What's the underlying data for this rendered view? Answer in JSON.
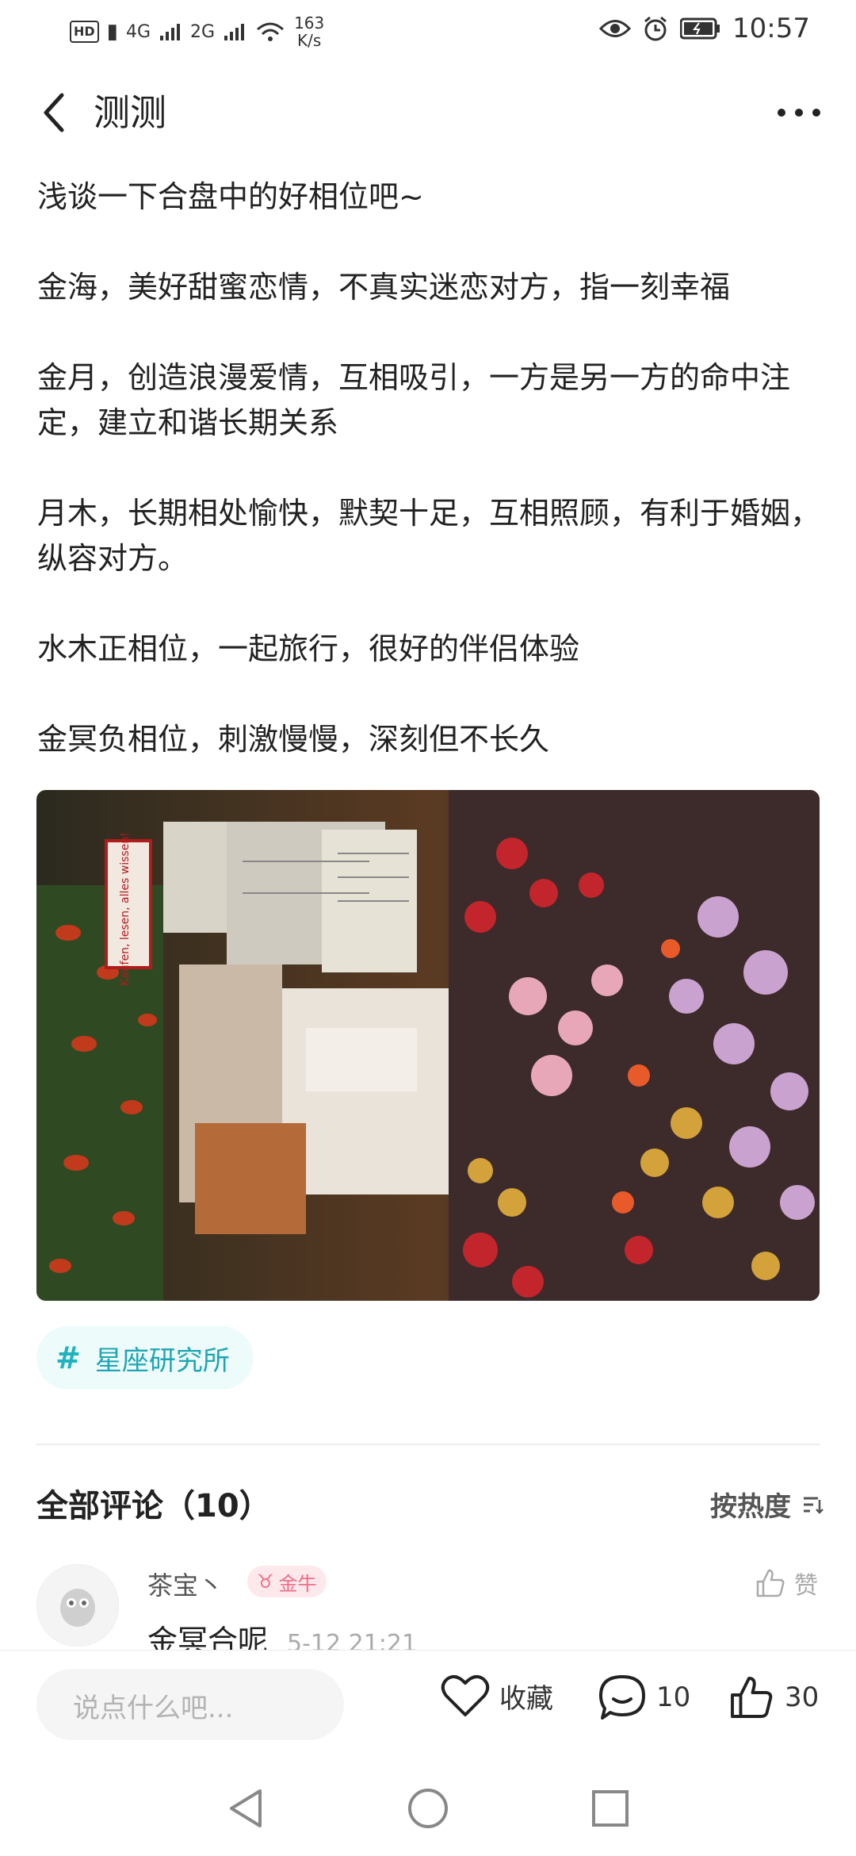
{
  "status_bar": {
    "hd": "HD",
    "signal1": "4G",
    "signal2": "2G",
    "speed_value": "163",
    "speed_unit": "K/s",
    "time": "10:57"
  },
  "header": {
    "title": "测测"
  },
  "post": {
    "paragraphs": [
      "浅谈一下合盘中的好相位吧~",
      "金海，美好甜蜜恋情，不真实迷恋对方，指一刻幸福",
      "金月，创造浪漫爱情，互相吸引，一方是另一方的命中注定，建立和谐长期关系",
      "月木，长期相处愉快，默契十足，互相照顾，有利于婚姻，纵容对方。",
      "水木正相位，一起旅行，很好的伴侣体验",
      "金冥负相位，刺激慢慢，深刻但不长久"
    ],
    "photo_sign_text": "Kaufen, lesen, alles wissen!"
  },
  "tag": {
    "label": "星座研究所"
  },
  "comments": {
    "title": "全部评论（10）",
    "sort_label": "按热度",
    "items": [
      {
        "user": "茶宝丶",
        "badge": "金牛",
        "like_label": "赞",
        "text": "金冥合呢",
        "time": "5-12 21:21"
      }
    ]
  },
  "bottom_bar": {
    "input_placeholder": "说点什么吧...",
    "collect_label": "收藏",
    "comment_count": "10",
    "like_count": "30"
  },
  "colors": {
    "accent": "#1fb3bf",
    "badge": "#ee6d86",
    "text": "#222222"
  }
}
